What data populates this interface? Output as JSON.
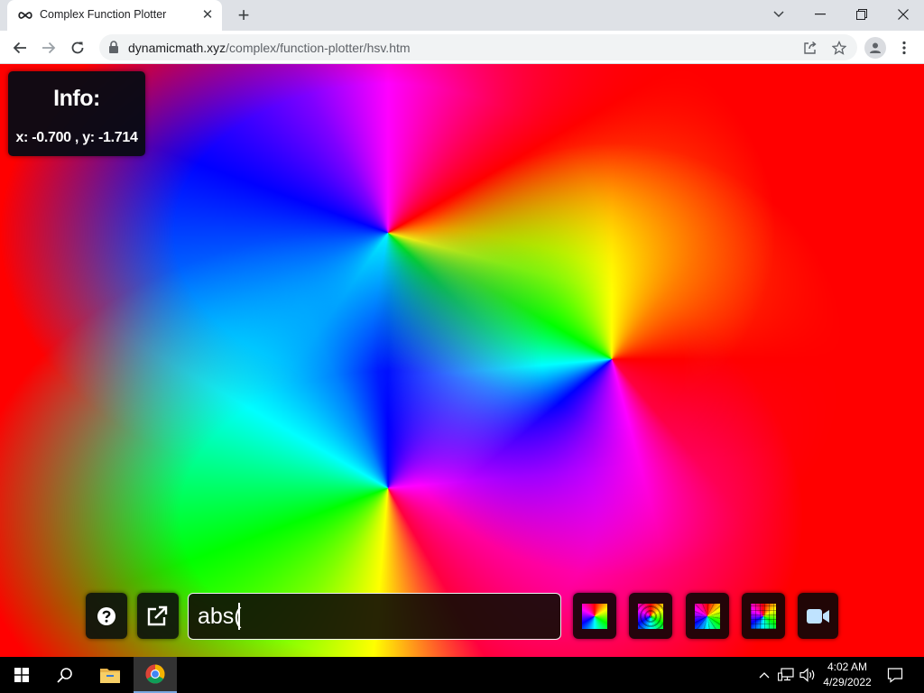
{
  "browser": {
    "tab_title": "Complex Function Plotter",
    "tab_icon": "infinity-icon",
    "url_host": "dynamicmath.xyz",
    "url_path": "/complex/function-plotter/hsv.htm"
  },
  "info": {
    "title": "Info:",
    "coords": "x: -0.700 , y: -1.714"
  },
  "controls": {
    "function_value": "abs(",
    "help_icon": "question-circle-icon",
    "open_icon": "external-link-icon",
    "colormaps": [
      "colormap-1",
      "colormap-2",
      "colormap-3",
      "colormap-4"
    ],
    "record_icon": "video-camera-icon"
  },
  "taskbar": {
    "time": "4:02 AM",
    "date": "4/29/2022",
    "apps": [
      "windows-start-icon",
      "search-icon",
      "file-explorer-icon",
      "chrome-icon"
    ]
  },
  "colors": {
    "chrome_bg": "#dee1e6",
    "info_bg": "#080a14",
    "taskbar_bg": "#000000"
  }
}
